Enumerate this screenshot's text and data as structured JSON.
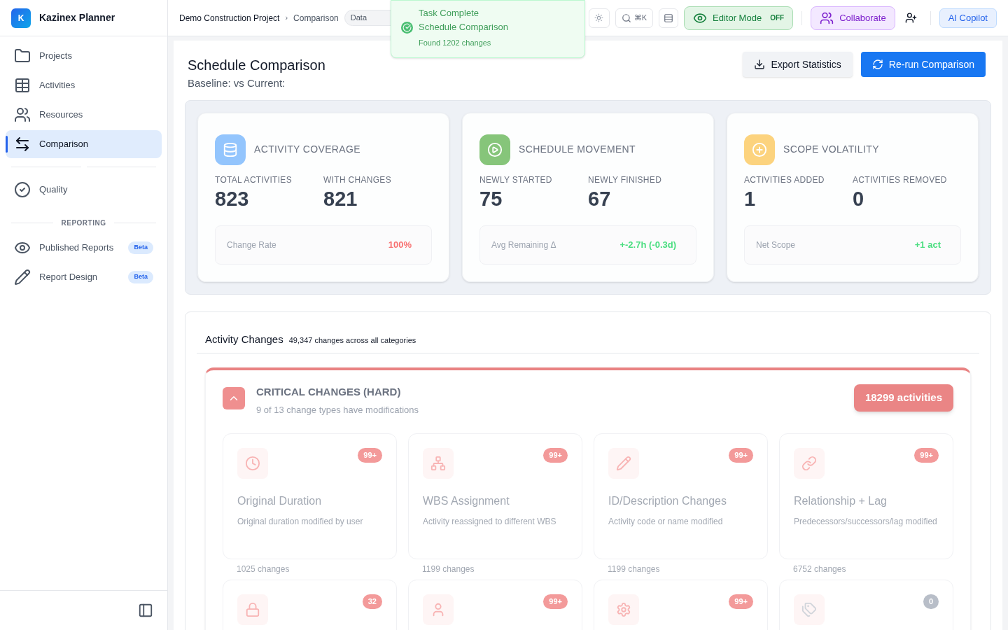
{
  "app": {
    "logo_letter": "K",
    "name": "Kazinex Planner"
  },
  "sidebar": {
    "sections": [
      {
        "items": [
          {
            "label": "Projects",
            "selected": false
          },
          {
            "label": "Activities",
            "selected": false
          },
          {
            "label": "Resources",
            "selected": false
          },
          {
            "label": "Comparison",
            "selected": true
          }
        ]
      },
      {
        "items": [
          {
            "label": "Quality",
            "selected": false
          }
        ]
      },
      {
        "heading": "REPORTING",
        "items": [
          {
            "label": "Published Reports",
            "selected": false,
            "badge": "Beta"
          },
          {
            "label": "Report Design",
            "selected": false,
            "badge": "Beta"
          }
        ]
      }
    ]
  },
  "topbar": {
    "breadcrumb": [
      "Demo Construction Project",
      "Comparison"
    ],
    "separator": "›",
    "data_date": "Data",
    "shortcut": "⌘K",
    "editor_mode": {
      "label": "Editor Mode",
      "state": "OFF",
      "on": false
    },
    "collaborate": "Collaborate",
    "ai_copilot": "AI Copilot"
  },
  "toast": {
    "title": "Task Complete",
    "subtitle": "Schedule Comparison",
    "message": "Found 1202 changes"
  },
  "page": {
    "title": "Schedule Comparison",
    "subtitle": "Baseline: vs Current:",
    "buttons": [
      {
        "label": "Export Statistics",
        "kind": "secondary"
      },
      {
        "label": "Re-run Comparison",
        "kind": "primary"
      }
    ]
  },
  "stat_cards": [
    {
      "title": "ACTIVITY COVERAGE",
      "color": "#93c5fd",
      "metrics": [
        {
          "label": "TOTAL ACTIVITIES",
          "value": "823"
        },
        {
          "label": "WITH CHANGES",
          "value": "821"
        }
      ],
      "footer": {
        "label": "Change Rate",
        "value": "100%",
        "color": "#f87171"
      }
    },
    {
      "title": "SCHEDULE MOVEMENT",
      "color": "#86c57a",
      "metrics": [
        {
          "label": "NEWLY STARTED",
          "value": "75"
        },
        {
          "label": "NEWLY FINISHED",
          "value": "67"
        }
      ],
      "footer": {
        "label": "Avg Remaining Δ",
        "value": "+-2.7h (-0.3d)",
        "color": "#4ade80"
      }
    },
    {
      "title": "SCOPE VOLATILITY",
      "color": "#fcd37e",
      "metrics": [
        {
          "label": "ACTIVITIES ADDED",
          "value": "1"
        },
        {
          "label": "ACTIVITIES REMOVED",
          "value": "0"
        }
      ],
      "footer": {
        "label": "Net Scope",
        "value": "+1 act",
        "color": "#4ade80"
      }
    }
  ],
  "activity_changes": {
    "title": "Activity Changes",
    "summary": "49,347 changes across all categories",
    "groups": [
      {
        "title": "CRITICAL CHANGES (HARD)",
        "subtitle": "9 of 13 change types have modifications",
        "count": "18299 activities",
        "expanded": true,
        "change_types": [
          {
            "badge": "99+",
            "highlighted": true,
            "title": "Original Duration",
            "description": "Original duration modified by user",
            "changes": "1025 changes"
          },
          {
            "badge": "99+",
            "highlighted": true,
            "title": "WBS Assignment",
            "description": "Activity reassigned to different WBS",
            "changes": "1199 changes"
          },
          {
            "badge": "99+",
            "highlighted": true,
            "title": "ID/Description Changes",
            "description": "Activity code or name modified",
            "changes": "1199 changes"
          },
          {
            "badge": "99+",
            "highlighted": true,
            "title": "Relationship + Lag",
            "description": "Predecessors/successors/lag modified",
            "changes": "6752 changes"
          },
          {
            "badge": "32",
            "highlighted": true
          },
          {
            "badge": "99+",
            "highlighted": true
          },
          {
            "badge": "99+",
            "highlighted": true
          },
          {
            "badge": "0",
            "highlighted": false
          }
        ]
      }
    ]
  }
}
